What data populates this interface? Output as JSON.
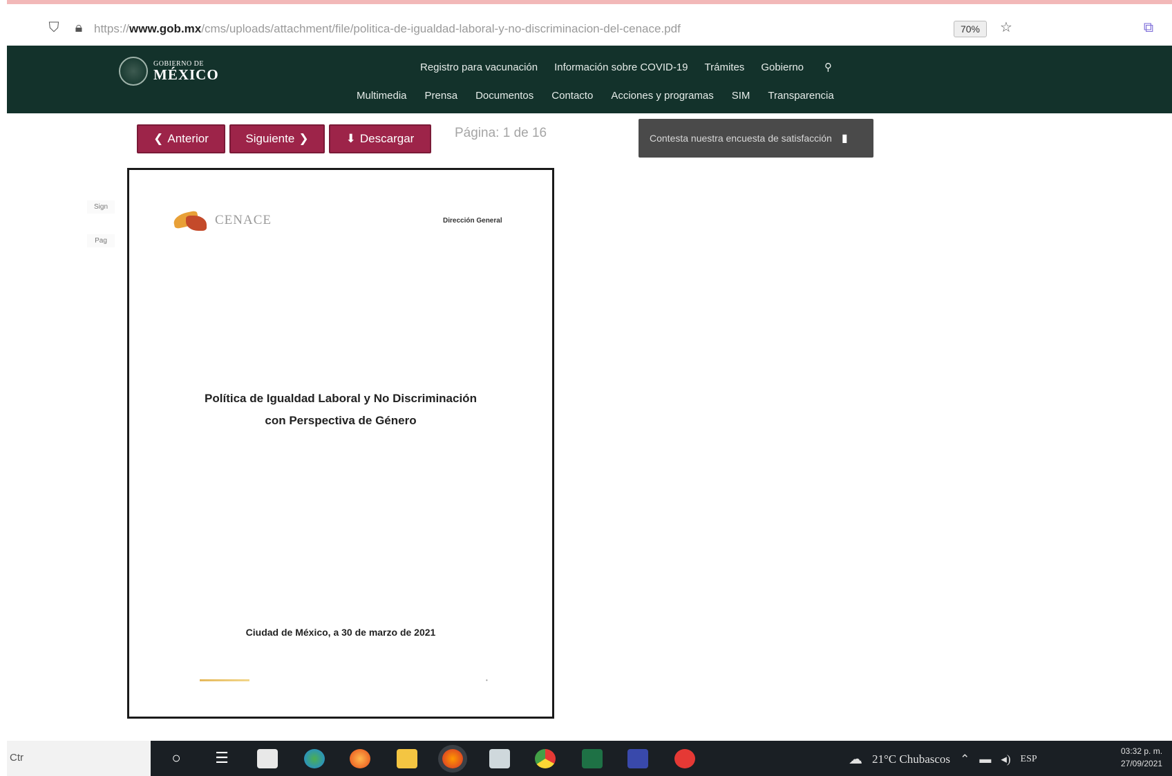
{
  "browser": {
    "url_domain": "www.gob.mx",
    "url_path": "/cms/uploads/attachment/file/politica-de-igualdad-laboral-y-no-discriminacion-del-cenace.pdf",
    "url_scheme": "https://",
    "zoom": "70%",
    "icons": [
      "shield-icon",
      "lock-icon",
      "star-icon",
      "extension-icon"
    ]
  },
  "gob_header": {
    "logo_small": "GOBIERNO DE",
    "logo_big": "MÉXICO",
    "top_nav": [
      "Registro para vacunación",
      "Información sobre COVID-19",
      "Trámites",
      "Gobierno"
    ],
    "sub_nav": [
      "Multimedia",
      "Prensa",
      "Documentos",
      "Contacto",
      "Acciones y programas",
      "SIM",
      "Transparencia"
    ],
    "colors": {
      "header_bg": "#13322b",
      "button_bg": "#9d2449"
    }
  },
  "viewer": {
    "prev_label": "Anterior",
    "next_label": "Siguiente",
    "download_label": "Descargar",
    "page_count": "Página: 1 de 16",
    "survey_text": "Contesta nuestra encuesta de satisfacción"
  },
  "side": {
    "labels": [
      "Sign",
      "Pag"
    ]
  },
  "document": {
    "logo_text": "CENACE",
    "corner_text": "Dirección General",
    "title_line1": "Política de Igualdad Laboral y No Discriminación",
    "title_line2": "con Perspectiva de Género",
    "date": "Ciudad de México, a 30 de marzo de 2021"
  },
  "taskbar": {
    "search_text": "Ctr",
    "weather": "21°C  Chubascos",
    "language": "ESP",
    "time": "03:32 p. m.",
    "date": "27/09/2021",
    "apps": [
      "cortana-icon",
      "task-view-icon",
      "store-icon",
      "chrome-app-icon",
      "firefox-icon",
      "file-explorer-icon",
      "firefox-active-icon",
      "paint-icon",
      "chrome-icon",
      "excel-icon",
      "remote-app-icon",
      "acrobat-icon"
    ]
  }
}
